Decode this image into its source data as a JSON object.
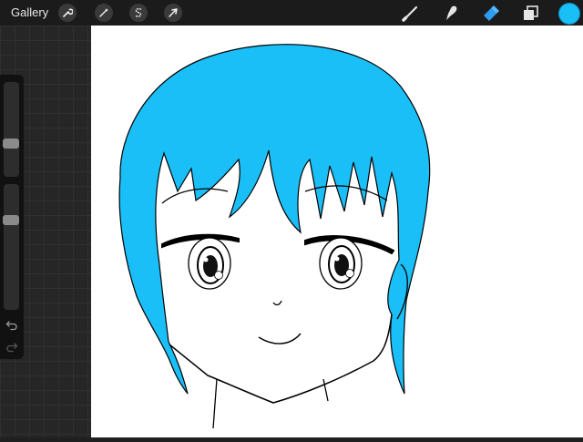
{
  "toolbar": {
    "gallery_label": "Gallery",
    "left_tools": [
      "wrench-icon",
      "magic-wand-icon",
      "selection-s-icon",
      "arrow-cursor-icon"
    ],
    "right_tools": [
      "brush-icon",
      "smudge-icon",
      "eraser-icon",
      "layers-icon"
    ],
    "active_tool": "eraser-icon",
    "current_color": "#1bbff7"
  },
  "sidebar": {
    "brush_size_level": 0.48,
    "opacity_level": 0.62,
    "buttons": [
      "undo-icon",
      "redo-icon"
    ]
  },
  "canvas": {
    "background": "#ffffff",
    "hair_color": "#1bbff7",
    "line_color": "#000000"
  }
}
